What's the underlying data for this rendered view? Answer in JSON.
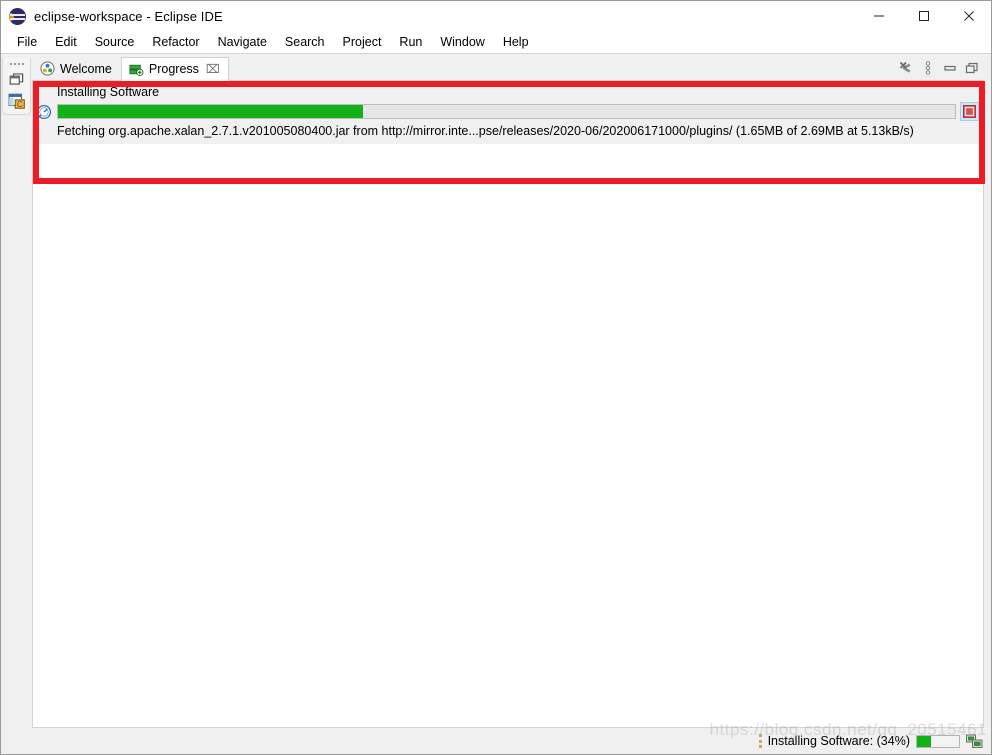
{
  "window": {
    "title": "eclipse-workspace - Eclipse IDE",
    "app_icon": "eclipse-icon",
    "controls": {
      "minimize": "—",
      "maximize": "☐",
      "close": "✕"
    }
  },
  "menubar": {
    "items": [
      {
        "label": "File"
      },
      {
        "label": "Edit"
      },
      {
        "label": "Source"
      },
      {
        "label": "Refactor"
      },
      {
        "label": "Navigate"
      },
      {
        "label": "Search"
      },
      {
        "label": "Project"
      },
      {
        "label": "Run"
      },
      {
        "label": "Window"
      },
      {
        "label": "Help"
      }
    ]
  },
  "left_rail": {
    "restore_icon": "restore-view-icon",
    "perspective_icon": "java-perspective-icon"
  },
  "tabs": [
    {
      "label": "Welcome",
      "icon": "welcome-icon",
      "active": false,
      "closable": false
    },
    {
      "label": "Progress",
      "icon": "progress-view-icon",
      "active": true,
      "closable": true,
      "close_glyph": "⌧"
    }
  ],
  "view_toolbar": {
    "buttons": [
      {
        "name": "remove-all-finished-icon",
        "tooltip": "Remove All Finished Operations"
      },
      {
        "name": "view-menu-icon",
        "tooltip": "View Menu"
      },
      {
        "name": "minimize-icon",
        "tooltip": "Minimize"
      },
      {
        "name": "maximize-icon",
        "tooltip": "Maximize"
      }
    ]
  },
  "progress_view": {
    "job": {
      "title": "Installing Software",
      "icon": "job-progress-icon",
      "detail": "Fetching org.apache.xalan_2.7.1.v201005080400.jar from http://mirror.inte...pse/releases/2020-06/202006171000/plugins/ (1.65MB of 2.69MB at 5.13kB/s)",
      "percent": 34,
      "bar_fill_color": "#12b118",
      "bar_track_color": "#e6e6e6",
      "stop_button": {
        "name": "stop-job-button",
        "color": "#e02020"
      }
    }
  },
  "annotation": {
    "color": "#ed1c24",
    "shape": "rectangle-highlight"
  },
  "statusbar": {
    "text": "Installing Software: (34%)",
    "percent": 34,
    "progress_color": "#12b118",
    "icon": "remote-connection-icon"
  },
  "watermark": {
    "text": "https://blog.csdn.net/qq_20515461"
  }
}
